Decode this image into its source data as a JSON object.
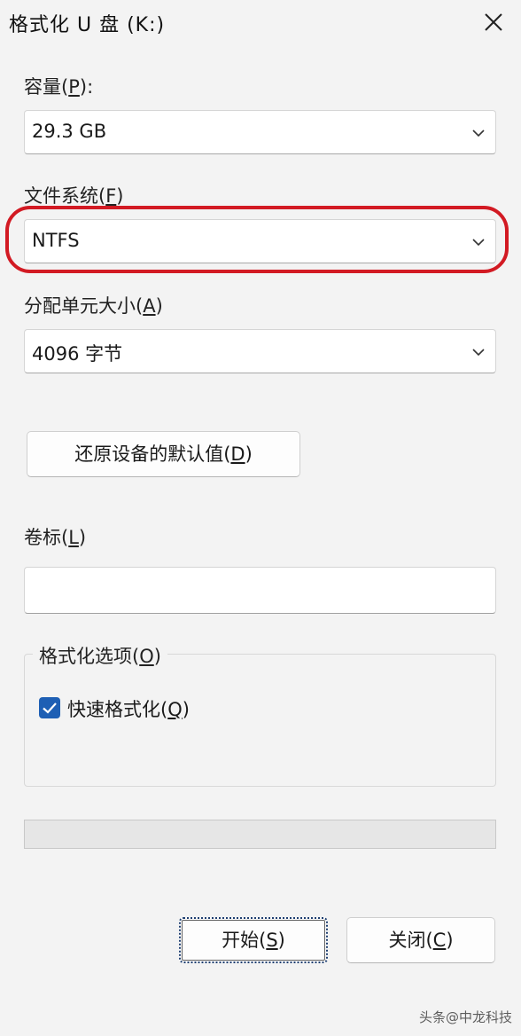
{
  "window": {
    "title": "格式化 U 盘 (K:)"
  },
  "capacity": {
    "label": "容量",
    "accel": "P",
    "suffix": ":",
    "value": "29.3 GB"
  },
  "filesystem": {
    "label": "文件系统",
    "accel": "F",
    "value": "NTFS",
    "highlight_color": "#d21a23"
  },
  "allocation": {
    "label": "分配单元大小",
    "accel": "A",
    "value": "4096 字节"
  },
  "restore_defaults": {
    "label": "还原设备的默认值",
    "accel": "D"
  },
  "volume_label": {
    "label": "卷标",
    "accel": "L",
    "value": ""
  },
  "format_options": {
    "label": "格式化选项",
    "accel": "O",
    "quick_format": {
      "label": "快速格式化",
      "accel": "Q",
      "checked": true
    }
  },
  "progress": {
    "value": 0
  },
  "buttons": {
    "start": {
      "label": "开始",
      "accel": "S"
    },
    "close": {
      "label": "关闭",
      "accel": "C"
    }
  },
  "watermark": {
    "text": "头条@中龙科技"
  },
  "colors": {
    "accent": "#1e5fb4",
    "highlight": "#d21a23"
  },
  "icons": {
    "close": "close-icon",
    "dropdown": "chevron-down-icon",
    "check": "checkmark-icon"
  }
}
